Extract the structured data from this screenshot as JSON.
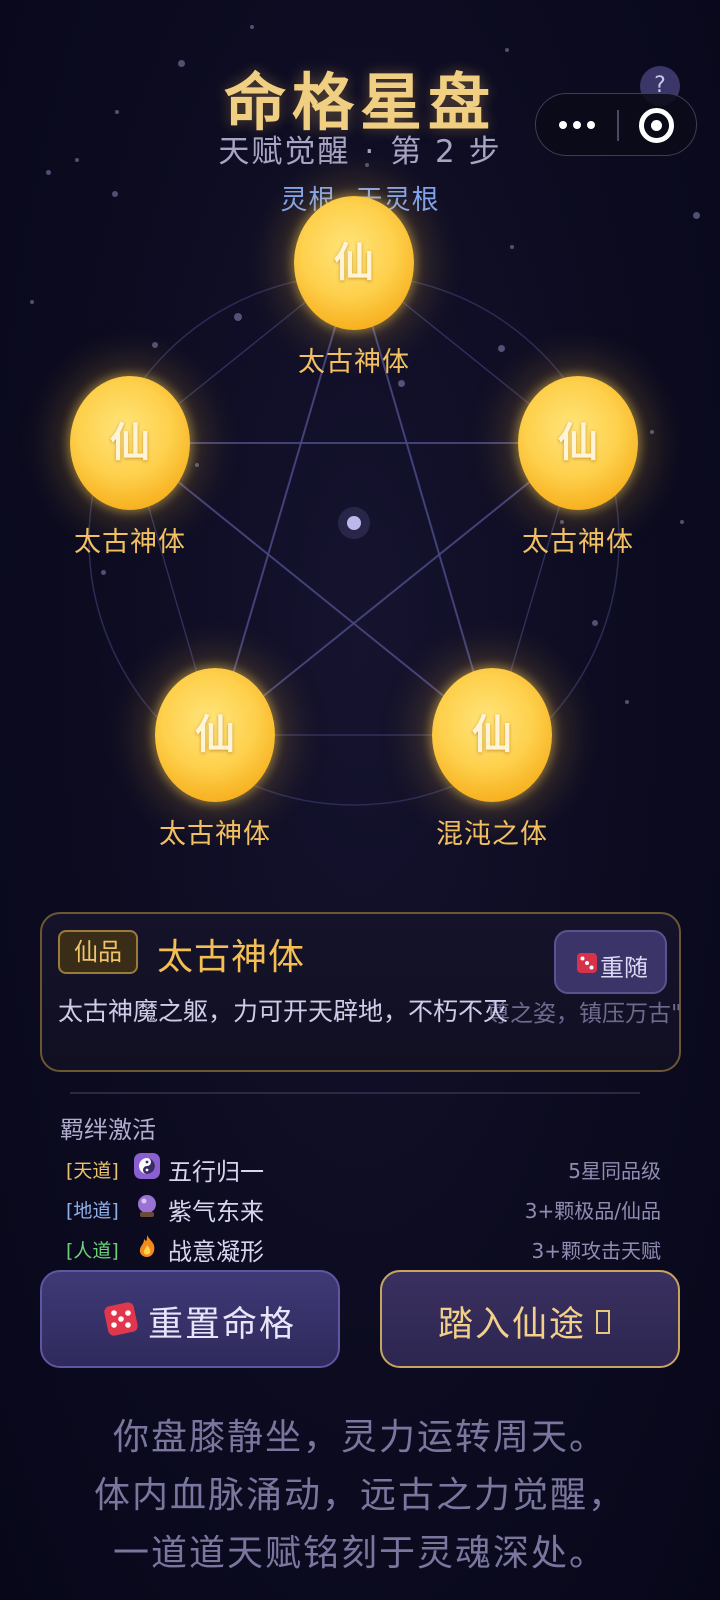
{
  "header": {
    "title": "命格星盘",
    "subtitle_stage": "天赋觉醒",
    "subtitle_dot": "·",
    "subtitle_step": "第 2 步",
    "root_label": "灵根· 天灵根"
  },
  "capsule": {
    "help": "?",
    "more_icon": "more-dots-icon",
    "close_icon": "target-close-icon"
  },
  "star_chart": {
    "nodes": [
      {
        "glyph": "仙",
        "label": "太古神体"
      },
      {
        "glyph": "仙",
        "label": "太古神体"
      },
      {
        "glyph": "仙",
        "label": "太古神体"
      },
      {
        "glyph": "仙",
        "label": "太古神体"
      },
      {
        "glyph": "仙",
        "label": "混沌之体"
      }
    ],
    "orb_color": "#fdc63e",
    "line_color": "#4b4a86"
  },
  "talent_card": {
    "grade": "仙品",
    "name": "太古神体",
    "reroll_label": "重随",
    "description": "太古神魔之躯，力可开天辟地，不朽不灭",
    "description_overflow": "尊之姿，镇压万古\""
  },
  "bonds": {
    "title": "羁绊激活",
    "items": [
      {
        "tag": "[天道]",
        "tag_color": "#e9c46a",
        "icon": "yin-yang-icon",
        "name": "五行归一",
        "condition": "5星同品级"
      },
      {
        "tag": "[地道]",
        "tag_color": "#8fb0e8",
        "icon": "crystal-ball-icon",
        "name": "紫气东来",
        "condition": "3+颗极品/仙品"
      },
      {
        "tag": "[人道]",
        "tag_color": "#6cd07a",
        "icon": "fire-icon",
        "name": "战意凝形",
        "condition": "3+颗攻击天赋"
      }
    ]
  },
  "actions": {
    "reset_label": "重置命格",
    "enter_label": "踏入仙途"
  },
  "narration": [
    "你盘膝静坐，灵力运转周天。",
    "体内血脉涌动，远古之力觉醒，",
    "一道道天赋铭刻于灵魂深处。"
  ]
}
